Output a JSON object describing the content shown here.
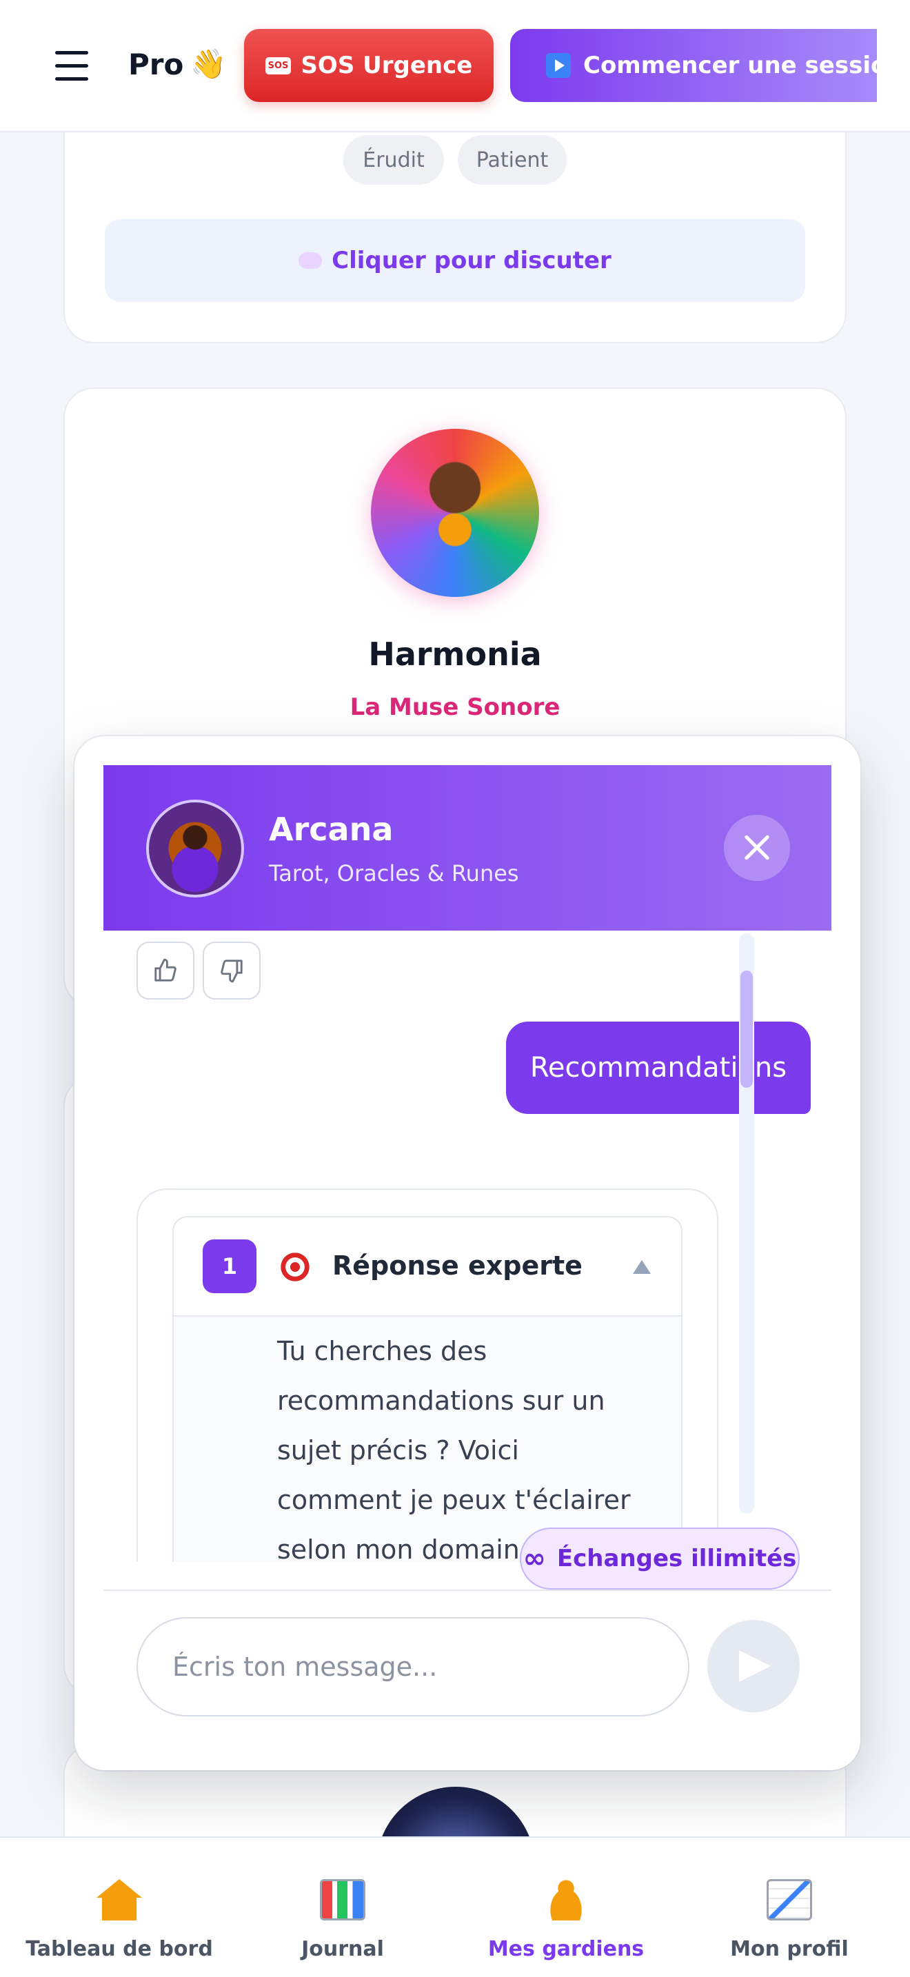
{
  "header": {
    "menu_icon": "hamburger-icon",
    "pro_label": "Pro",
    "pro_emoji": "👋",
    "sos_badge": "SOS",
    "sos_label": "SOS Urgence",
    "session_label": "Commencer une session",
    "session_icon": "play-icon"
  },
  "background": {
    "card1": {
      "tags": [
        "Érudit",
        "Patient"
      ],
      "chat_cta": "Cliquer pour discuter",
      "chat_cta_icon": "speech-bubble-icon"
    },
    "card2": {
      "name": "Harmonia",
      "role": "La Muse Sonore"
    }
  },
  "chat": {
    "guardian_name": "Arcana",
    "guardian_subtitle": "Tarot, Oracles & Runes",
    "close_icon": "close-icon",
    "feedback": {
      "like_icon": "thumbs-up-icon",
      "dislike_icon": "thumbs-down-icon"
    },
    "user_message": "Recommandations",
    "response": {
      "number": "1",
      "icon": "target-icon",
      "title": "Réponse experte",
      "body": "Tu cherches des recommandations sur un sujet précis ? Voici comment je peux t'éclairer selon mon domaine d'expertise (Tarot,"
    },
    "unlimited_symbol": "∞",
    "unlimited_label": "Échanges illimités",
    "input_placeholder": "Écris ton message...",
    "input_value": "",
    "send_icon": "send-icon"
  },
  "nav": {
    "items": [
      {
        "label": "Tableau de bord",
        "icon": "house-icon",
        "active": false
      },
      {
        "label": "Journal",
        "icon": "bar-chart-icon",
        "active": false
      },
      {
        "label": "Mes gardiens",
        "icon": "meditation-icon",
        "active": true
      },
      {
        "label": "Mon profil",
        "icon": "line-chart-icon",
        "active": false
      }
    ]
  },
  "colors": {
    "accent": "#7c3aed",
    "sos": "#dc2626",
    "role_pink": "#db2777"
  }
}
